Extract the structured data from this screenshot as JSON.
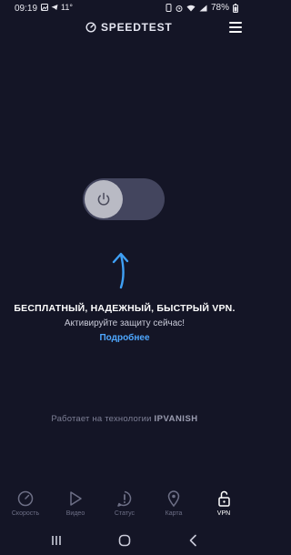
{
  "status_bar": {
    "time": "09:19",
    "temp": "11°",
    "battery": "78%"
  },
  "header": {
    "app_name": "SPEEDTEST"
  },
  "promo": {
    "headline": "БЕСПЛАТНЫЙ, НАДЕЖНЫЙ, БЫСТРЫЙ VPN.",
    "subline": "Активируйте защиту сейчас!",
    "link": "Подробнее"
  },
  "footer": {
    "powered_prefix": "Работает на технологии",
    "brand_light": "IP",
    "brand_bold": "VANISH"
  },
  "vpn_toggle": {
    "state": "off"
  },
  "tabs": [
    {
      "label": "Скорость",
      "icon": "speedometer-icon"
    },
    {
      "label": "Видео",
      "icon": "play-icon"
    },
    {
      "label": "Статус",
      "icon": "alert-icon"
    },
    {
      "label": "Карта",
      "icon": "map-pin-icon"
    },
    {
      "label": "VPN",
      "icon": "unlock-icon",
      "active": true
    }
  ],
  "colors": {
    "background": "#141526",
    "accent": "#4ea7ff",
    "toggle_track": "#43455e",
    "knob": "#b9bac4"
  }
}
